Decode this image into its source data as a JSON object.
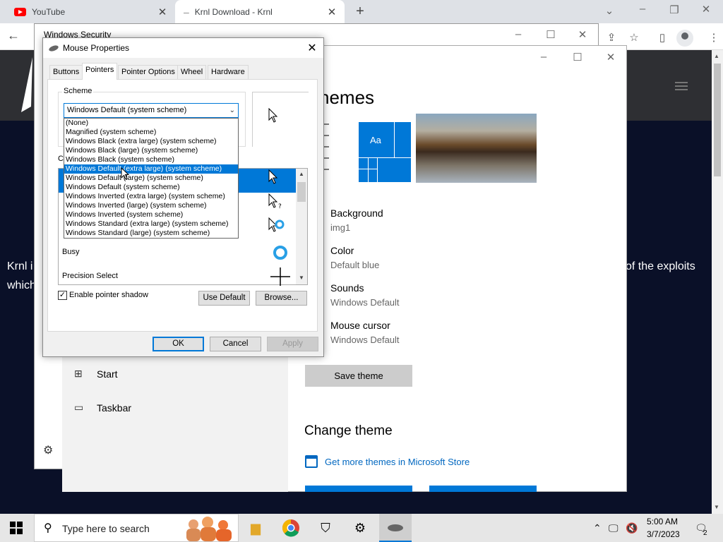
{
  "browser": {
    "tabs": [
      {
        "title": "YouTube"
      },
      {
        "title": "Krnl Download - Krnl"
      }
    ],
    "new_tab": "+",
    "close_glyph": "✕",
    "back_glyph": "←"
  },
  "site": {
    "line1_left": "Krnl i",
    "line1_right": "of the exploits",
    "line2_left": "which"
  },
  "windows_security": {
    "title": "Windows Security"
  },
  "settings": {
    "heading": "hemes",
    "preview_tile_text": "Aa",
    "items": [
      {
        "key": "Background",
        "value": "img1"
      },
      {
        "key": "Color",
        "value": "Default blue"
      },
      {
        "key": "Sounds",
        "value": "Windows Default"
      },
      {
        "key": "Mouse cursor",
        "value": "Windows Default"
      }
    ],
    "save_theme": "Save theme",
    "change_theme": "Change theme",
    "store_link": "Get more themes in Microsoft Store",
    "nav": [
      {
        "label": "Start",
        "icon": "start-layout-icon"
      },
      {
        "label": "Taskbar",
        "icon": "taskbar-icon"
      }
    ]
  },
  "mouse_properties": {
    "title": "Mouse Properties",
    "tabs": [
      "Buttons",
      "Pointers",
      "Pointer Options",
      "Wheel",
      "Hardware"
    ],
    "active_tab": "Pointers",
    "scheme_label": "Scheme",
    "scheme_selected": "Windows Default (system scheme)",
    "customize_label": "Cu",
    "scheme_options": [
      "(None)",
      "Magnified (system scheme)",
      "Windows Black (extra large) (system scheme)",
      "Windows Black (large) (system scheme)",
      "Windows Black (system scheme)",
      "Windows Default (extra large) (system scheme)",
      "Windows Default (large) (system scheme)",
      "Windows Default (system scheme)",
      "Windows Inverted (extra large) (system scheme)",
      "Windows Inverted (large) (system scheme)",
      "Windows Inverted (system scheme)",
      "Windows Standard (extra large) (system scheme)",
      "Windows Standard (large) (system scheme)"
    ],
    "highlighted_option": "Windows Default (extra large) (system scheme)",
    "cursor_rows": [
      "Busy",
      "Precision Select"
    ],
    "enable_shadow": "Enable pointer shadow",
    "shadow_checked": true,
    "use_default": "Use Default",
    "browse": "Browse...",
    "ok": "OK",
    "cancel": "Cancel",
    "apply": "Apply"
  },
  "taskbar": {
    "search_placeholder": "Type here to search",
    "time": "5:00 AM",
    "date": "3/7/2023",
    "notification_count": "2"
  },
  "colors": {
    "accent": "#0078d7",
    "site_bg": "#0a1028",
    "youtube_red": "#ff0000"
  }
}
